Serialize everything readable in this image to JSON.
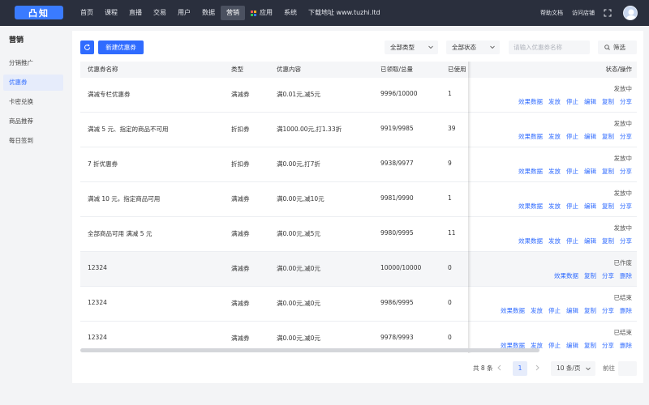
{
  "logo": "凸知",
  "nav": {
    "items": [
      "首页",
      "课程",
      "直播",
      "交易",
      "用户",
      "数据",
      "营销",
      "应用",
      "系统",
      "下载地址 www.tuzhi.ltd"
    ],
    "active": "营销",
    "help": "帮助文档",
    "visit": "访问店铺"
  },
  "sidebar": {
    "title": "营销",
    "items": [
      "分销推广",
      "优惠券",
      "卡密兑换",
      "商品推荐",
      "每日签到"
    ],
    "active": "优惠券"
  },
  "toolbar": {
    "new_button": "新建优惠券",
    "type_select": "全部类型",
    "status_select": "全部状态",
    "search_placeholder": "请输入优惠券名称",
    "filter_button": "筛选"
  },
  "table": {
    "headers": [
      "优惠券名称",
      "类型",
      "优惠内容",
      "已领取/总量",
      "已使用",
      "状态/操作"
    ],
    "rows": [
      {
        "name": "满减专栏优惠券",
        "type": "满减券",
        "content": "满0.01元,减5元",
        "claimed": "9996/10000",
        "used": "1",
        "status": "发放中",
        "actions": [
          "效果数据",
          "发放",
          "停止",
          "编辑",
          "复制",
          "分享"
        ]
      },
      {
        "name": "满减 5 元、指定的商品不可用",
        "type": "折扣券",
        "content": "满1000.00元,打1.33折",
        "claimed": "9919/9985",
        "used": "39",
        "status": "发放中",
        "actions": [
          "效果数据",
          "发放",
          "停止",
          "编辑",
          "复制",
          "分享"
        ]
      },
      {
        "name": "7 折优惠券",
        "type": "折扣券",
        "content": "满0.00元,打7折",
        "claimed": "9938/9977",
        "used": "9",
        "status": "发放中",
        "actions": [
          "效果数据",
          "发放",
          "停止",
          "编辑",
          "复制",
          "分享"
        ]
      },
      {
        "name": "满减 10 元，指定商品可用",
        "type": "满减券",
        "content": "满0.00元,减10元",
        "claimed": "9981/9990",
        "used": "1",
        "status": "发放中",
        "actions": [
          "效果数据",
          "发放",
          "停止",
          "编辑",
          "复制",
          "分享"
        ]
      },
      {
        "name": "全部商品可用 满减 5 元",
        "type": "满减券",
        "content": "满0.00元,减5元",
        "claimed": "9980/9995",
        "used": "11",
        "status": "发放中",
        "actions": [
          "效果数据",
          "发放",
          "停止",
          "编辑",
          "复制",
          "分享"
        ]
      },
      {
        "name": "12324",
        "type": "满减券",
        "content": "满0.00元,减0元",
        "claimed": "10000/10000",
        "used": "0",
        "status": "已作废",
        "actions": [
          "效果数据",
          "复制",
          "分享",
          "删除"
        ]
      },
      {
        "name": "12324",
        "type": "满减券",
        "content": "满0.00元,减0元",
        "claimed": "9986/9995",
        "used": "0",
        "status": "已结束",
        "actions": [
          "效果数据",
          "发放",
          "停止",
          "编辑",
          "复制",
          "分享",
          "删除"
        ]
      },
      {
        "name": "12324",
        "type": "满减券",
        "content": "满0.00元,减0元",
        "claimed": "9978/9993",
        "used": "0",
        "status": "已结束",
        "actions": [
          "效果数据",
          "发放",
          "停止",
          "编辑",
          "复制",
          "分享",
          "删除"
        ]
      }
    ]
  },
  "pagination": {
    "total": "共 8 条",
    "current_page": "1",
    "page_size": "10 条/页",
    "goto_label": "前往"
  },
  "colors": {
    "primary": "#2f6bff",
    "topbar": "#2a2f3d"
  }
}
